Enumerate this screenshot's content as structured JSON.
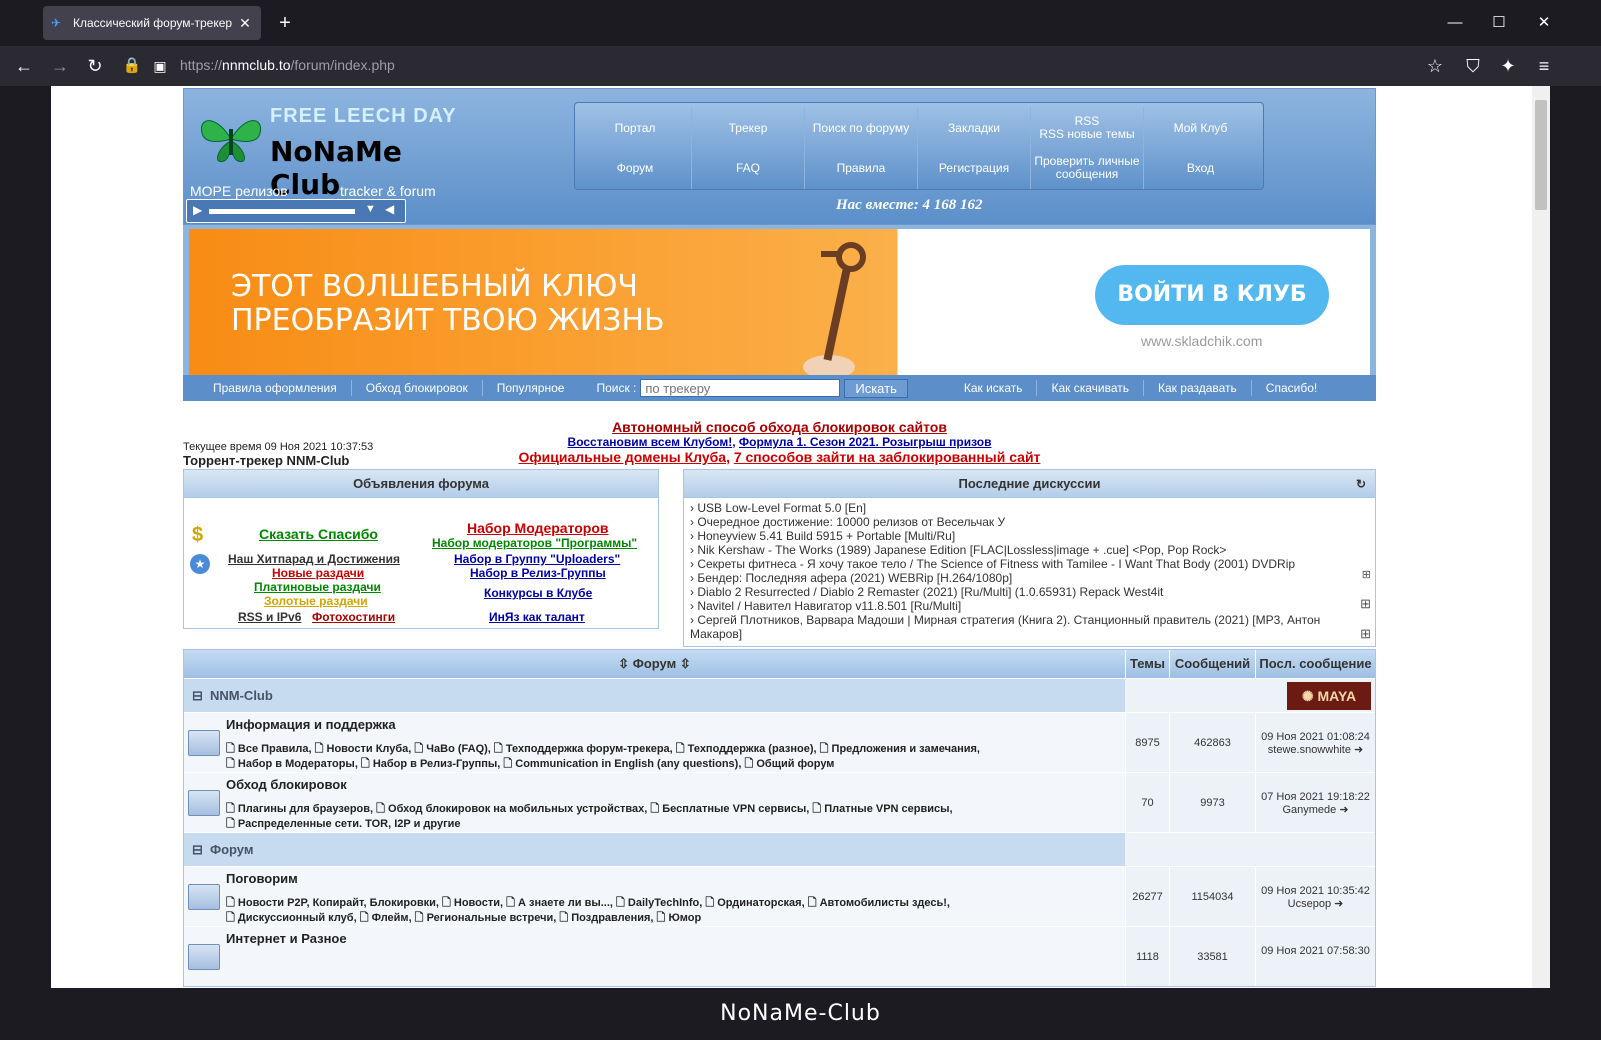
{
  "browser": {
    "tab_title": "Классический форум-трекер",
    "url_prefix": "https://",
    "url_host": "nnmclub.to",
    "url_path": "/forum/index.php",
    "bottom_label": "NoNaMe-Club"
  },
  "header": {
    "leech": "FREE LEECH DAY",
    "logo": "NoNaMe Club",
    "slogan_left": "МОРЕ релизов",
    "slogan_right": "tracker & forum",
    "together": "Нас вместе: 4 168 162",
    "nav_top": [
      "Портал",
      "Трекер",
      "Поиск по форуму",
      "Закладки",
      "RSS\nRSS новые темы",
      "Мой Клуб"
    ],
    "nav_bottom": [
      "Форум",
      "FAQ",
      "Правила",
      "Регистрация",
      "Проверить личные сообщения",
      "Вход"
    ]
  },
  "banner": {
    "line1": "ЭТОТ ВОЛШЕБНЫЙ КЛЮЧ",
    "line2": "ПРЕОБРАЗИТ ТВОЮ ЖИЗНЬ",
    "button": "ВОЙТИ В КЛУБ",
    "site": "www.skladchik.com"
  },
  "menubar": {
    "left": [
      "Правила оформления",
      "Обход блокировок",
      "Популярное"
    ],
    "search_label": "Поиск :",
    "search_placeholder": "по трекеру",
    "search_button": "Искать",
    "right": [
      "Как искать",
      "Как скачивать",
      "Как раздавать",
      "Спасибо!"
    ]
  },
  "news": {
    "line1": "Автономный способ обхода блокировок сайтов",
    "line2a": "Восстановим всем Клубом!",
    "line2b": "Формула 1. Сезон 2021. Розыгрыш призов",
    "line3a": "Официальные домены Клуба",
    "line3b": "7 способов зайти на заблокированный сайт",
    "time": "Текущее время 09 Ноя 2021 10:37:53",
    "tracker": "Торрент-трекер NNM-Club"
  },
  "announcements": {
    "title": "Объявления форума",
    "links": [
      "Сказать Спасибо",
      "Наш Хитпарад и Достижения",
      "Новые раздачи",
      "Платиновые раздачи",
      "Золотые раздачи",
      "RSS и IPv6",
      "Фотохостинги",
      "Набор Модераторов",
      "Набор модераторов \"Программы\"",
      "Набор в Группу \"Uploaders\"",
      "Набор в Релиз-Группы",
      "Конкурсы в Клубе",
      "ИнЯз как талант"
    ]
  },
  "discussions": {
    "title": "Последние дискуссии",
    "items": [
      "USB Low-Level Format 5.0 [En]",
      "Очередное достижение: 10000 релизов от Весельчак У",
      "Honeyview 5.41 Build 5915 + Portable [Multi/Ru]",
      "Nik Kershaw - The Works (1989) Japanese Edition [FLAC|Lossless|image + .cue] <Pop, Pop Rock>",
      "Секреты фитнеса - Я хочу такое тело / The Science of Fitness with Tamilee - I Want That Body (2001) DVDRip",
      "Бендер: Последняя афера (2021) WEBRip [H.264/1080p]",
      "Diablo 2 Resurrected / Diablo 2 Remaster (2021) [Ru/Multi] (1.0.65931) Repack West4it",
      "Navitel / Навител Навигатор v11.8.501 [Ru/Multi]",
      "Сергей Плотников, Варвара Мадоши | Мирная стратегия (Книга 2). Станционный правитель (2021) [MP3, Антон Макаров]"
    ]
  },
  "forum": {
    "col_forum": "Форум",
    "col_topics": "Темы",
    "col_posts": "Сообщений",
    "col_last": "Посл. сообщение",
    "categories": [
      {
        "name": "NNM-Club"
      },
      {
        "name": "Форум"
      }
    ],
    "rows": [
      {
        "name": "Информация и поддержка",
        "subs": "🗋 Все Правила, 🗋 Новости Клуба, 🗋 ЧаВо (FAQ), 🗋 Техподдержка форум-трекера, 🗋 Техподдержка (разное), 🗋 Предложения и замечания,\n🗋 Набор в Модераторы, 🗋 Набор в Релиз-Группы, 🗋 Communication in English (any questions), 🗋 Общий форум",
        "topics": "8975",
        "posts": "462863",
        "last_date": "09 Ноя 2021 01:08:24",
        "last_user": "stewe.snowwhite"
      },
      {
        "name": "Обход блокировок",
        "subs": "🗋 Плагины для браузеров, 🗋 Обход блокировок на мобильных устройствах, 🗋 Бесплатные VPN сервисы, 🗋 Платные VPN сервисы,\n🗋 Распределенные сети. TOR, I2P и другие",
        "topics": "70",
        "posts": "9973",
        "last_date": "07 Ноя 2021 19:18:22",
        "last_user": "Ganymede"
      },
      {
        "name": "Поговорим",
        "subs": "🗋 Новости P2P, Копирайт, Блокировки, 🗋 Новости, 🗋 А знаете ли вы..., 🗋 DailyTechInfo, 🗋 Ординаторская, 🗋 Автомобилисты здесь!,\n🗋 Дискуссионный клуб, 🗋 Флейм, 🗋 Региональные встречи, 🗋 Поздравления, 🗋 Юмор",
        "topics": "26277",
        "posts": "1154034",
        "last_date": "09 Ноя 2021 10:35:42",
        "last_user": "Ucsepop"
      },
      {
        "name": "Интернет и Разное",
        "subs": "",
        "topics": "1118",
        "posts": "33581",
        "last_date": "09 Ноя 2021 07:58:30",
        "last_user": ""
      }
    ]
  }
}
